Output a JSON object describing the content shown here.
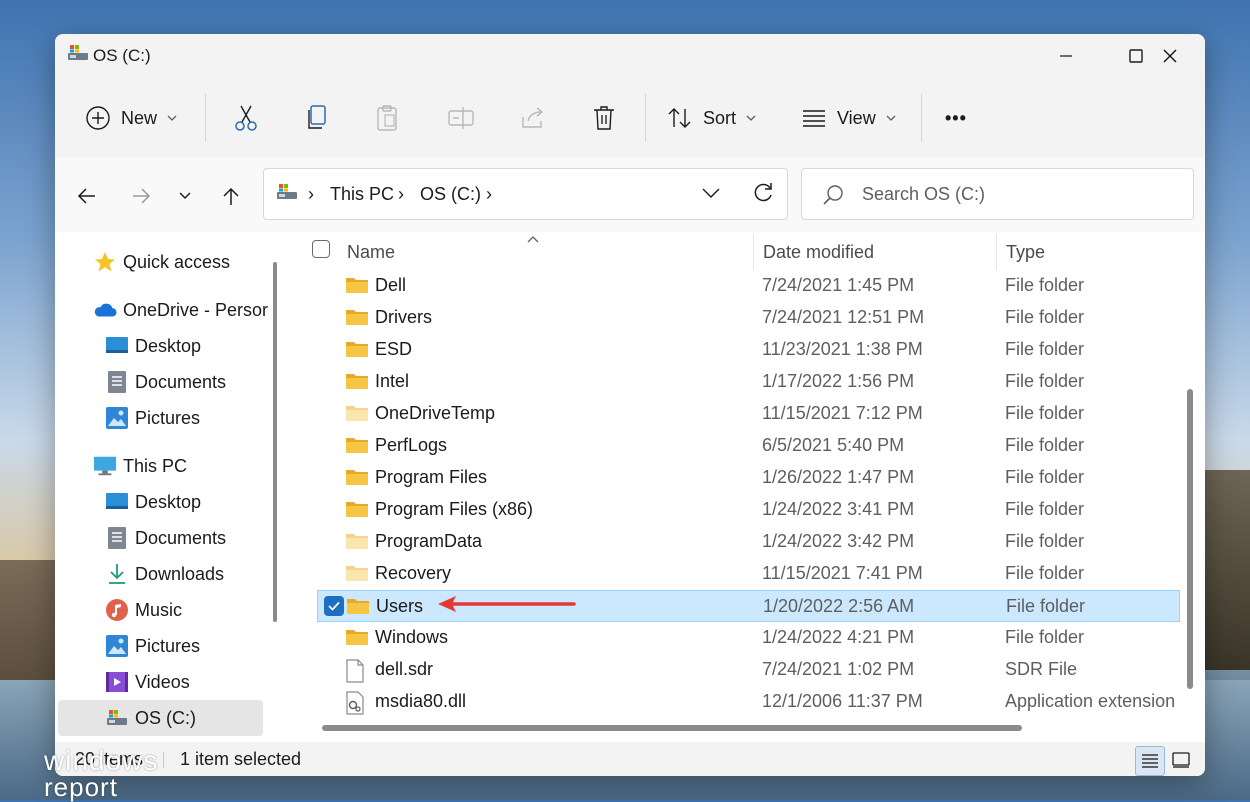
{
  "window": {
    "title": "OS (C:)"
  },
  "toolbar": {
    "new_label": "New",
    "sort_label": "Sort",
    "view_label": "View",
    "more_label": "•••"
  },
  "address": {
    "crumbs": [
      "This PC",
      "OS (C:)"
    ]
  },
  "search": {
    "placeholder": "Search OS (C:)"
  },
  "sidebar": {
    "items": [
      {
        "label": "Quick access",
        "icon": "star-icon"
      },
      {
        "label": "OneDrive - Persor",
        "icon": "cloud-icon"
      },
      {
        "label": "Desktop",
        "icon": "desktop-folder-icon"
      },
      {
        "label": "Documents",
        "icon": "documents-folder-icon"
      },
      {
        "label": "Pictures",
        "icon": "pictures-folder-icon"
      },
      {
        "label": "This PC",
        "icon": "computer-icon"
      },
      {
        "label": "Desktop",
        "icon": "desktop-folder-icon"
      },
      {
        "label": "Documents",
        "icon": "documents-folder-icon"
      },
      {
        "label": "Downloads",
        "icon": "downloads-icon"
      },
      {
        "label": "Music",
        "icon": "music-icon"
      },
      {
        "label": "Pictures",
        "icon": "pictures-folder-icon"
      },
      {
        "label": "Videos",
        "icon": "videos-icon"
      },
      {
        "label": "OS (C:)",
        "icon": "drive-icon"
      }
    ]
  },
  "columns": {
    "name": "Name",
    "date": "Date modified",
    "type": "Type"
  },
  "files": [
    {
      "name": "Dell",
      "date": "7/24/2021 1:45 PM",
      "type": "File folder",
      "kind": "folder"
    },
    {
      "name": "Drivers",
      "date": "7/24/2021 12:51 PM",
      "type": "File folder",
      "kind": "folder"
    },
    {
      "name": "ESD",
      "date": "11/23/2021 1:38 PM",
      "type": "File folder",
      "kind": "folder"
    },
    {
      "name": "Intel",
      "date": "1/17/2022 1:56 PM",
      "type": "File folder",
      "kind": "folder"
    },
    {
      "name": "OneDriveTemp",
      "date": "11/15/2021 7:12 PM",
      "type": "File folder",
      "kind": "folder-light"
    },
    {
      "name": "PerfLogs",
      "date": "6/5/2021 5:40 PM",
      "type": "File folder",
      "kind": "folder"
    },
    {
      "name": "Program Files",
      "date": "1/26/2022 1:47 PM",
      "type": "File folder",
      "kind": "folder"
    },
    {
      "name": "Program Files (x86)",
      "date": "1/24/2022 3:41 PM",
      "type": "File folder",
      "kind": "folder"
    },
    {
      "name": "ProgramData",
      "date": "1/24/2022 3:42 PM",
      "type": "File folder",
      "kind": "folder-light"
    },
    {
      "name": "Recovery",
      "date": "11/15/2021 7:41 PM",
      "type": "File folder",
      "kind": "folder-light"
    },
    {
      "name": "Users",
      "date": "1/20/2022 2:56 AM",
      "type": "File folder",
      "kind": "folder",
      "selected": true
    },
    {
      "name": "Windows",
      "date": "1/24/2022 4:21 PM",
      "type": "File folder",
      "kind": "folder"
    },
    {
      "name": "dell.sdr",
      "date": "7/24/2021 1:02 PM",
      "type": "SDR File",
      "kind": "file"
    },
    {
      "name": "msdia80.dll",
      "date": "12/1/2006 11:37 PM",
      "type": "Application extension",
      "kind": "dll"
    }
  ],
  "status": {
    "items_count": "20 items",
    "selected": "1 item selected"
  },
  "watermark": {
    "line1": "windows",
    "line2": "report"
  },
  "colors": {
    "accent": "#1d6fc1",
    "selection": "#cce8ff",
    "annotation_arrow": "#e53935",
    "folder": "#f6c544"
  }
}
